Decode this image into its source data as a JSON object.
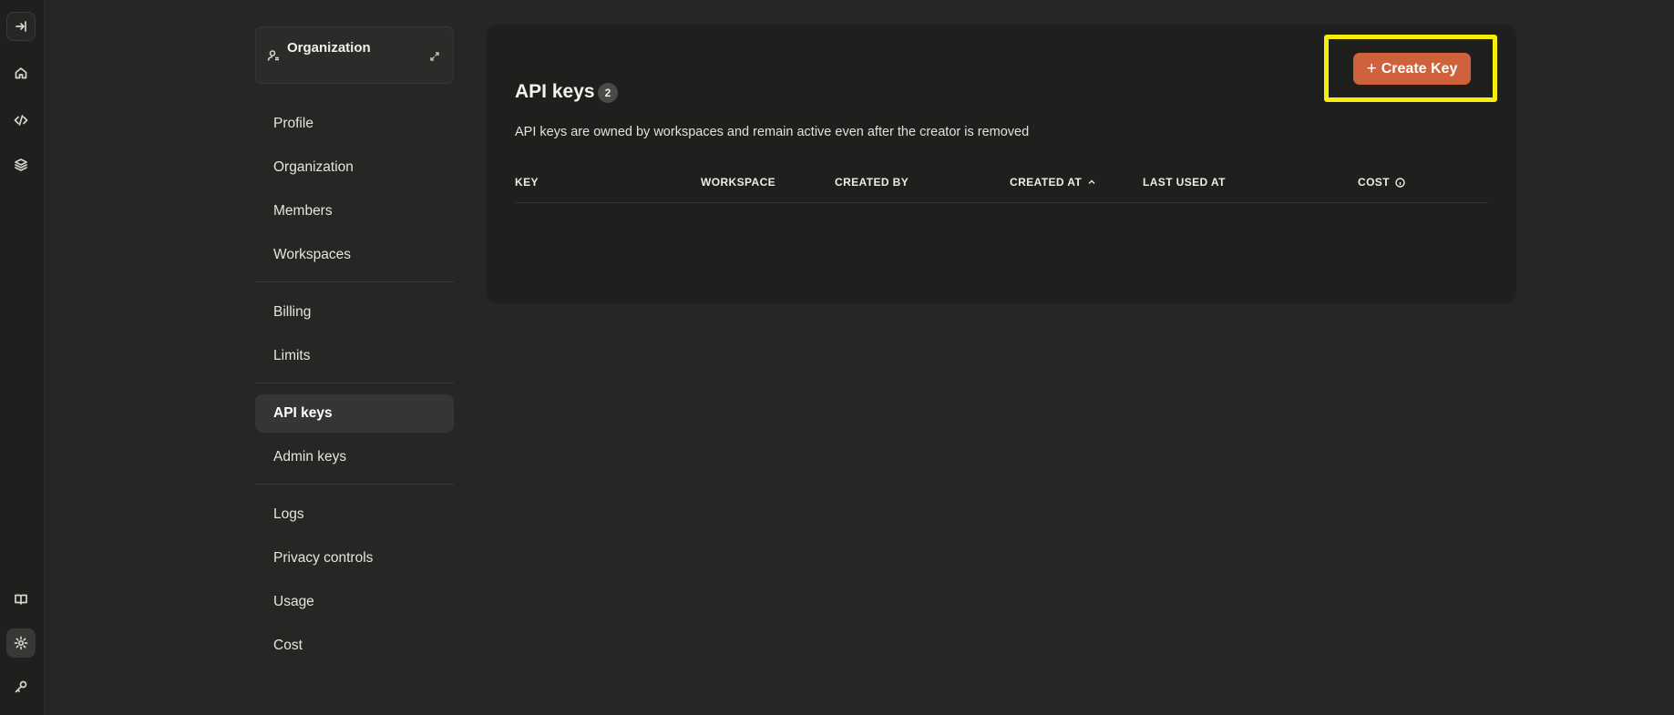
{
  "rail": {
    "items": [
      {
        "name": "collapse-sidebar-icon"
      },
      {
        "name": "home-icon"
      },
      {
        "name": "code-icon"
      },
      {
        "name": "layers-icon"
      },
      {
        "name": "book-icon"
      },
      {
        "name": "settings-icon"
      },
      {
        "name": "key-icon"
      }
    ]
  },
  "org_switcher": {
    "label": "Organization"
  },
  "nav": {
    "group1": [
      "Profile",
      "Organization",
      "Members",
      "Workspaces"
    ],
    "group2": [
      "Billing",
      "Limits"
    ],
    "group3": [
      "API keys",
      "Admin keys"
    ],
    "group4": [
      "Logs",
      "Privacy controls",
      "Usage",
      "Cost"
    ],
    "active": "API keys"
  },
  "main": {
    "title": "API keys",
    "count": "2",
    "description": "API keys are owned by workspaces and remain active even after the creator is removed",
    "create_button": "Create Key",
    "columns": [
      "KEY",
      "WORKSPACE",
      "CREATED BY",
      "CREATED AT",
      "LAST USED AT",
      "COST"
    ],
    "sorted_column": "CREATED AT",
    "sort_direction": "ascending"
  },
  "colors": {
    "accent": "#d0613d",
    "highlight": "#f7ef0a",
    "background": "#262625"
  }
}
